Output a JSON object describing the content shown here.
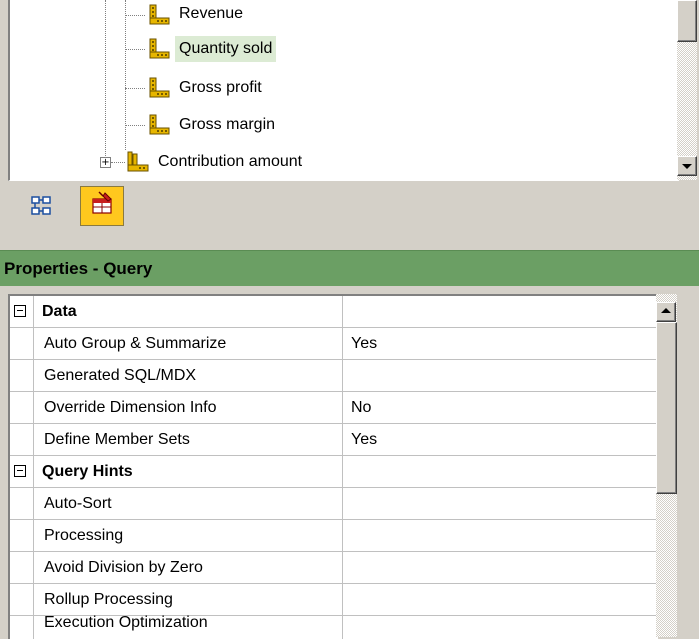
{
  "tree": {
    "items": [
      {
        "label": "Revenue",
        "icon": "measure-icon"
      },
      {
        "label": "Quantity sold",
        "icon": "measure-icon",
        "selected": true
      },
      {
        "label": "Gross profit",
        "icon": "measure-icon"
      },
      {
        "label": "Gross margin",
        "icon": "measure-icon"
      },
      {
        "label": "Contribution amount",
        "icon": "measure-folder-icon",
        "expandable": true
      }
    ]
  },
  "toolbar": {
    "buttons": [
      {
        "name": "tree-view-button",
        "icon": "tree-structure-icon",
        "active": false
      },
      {
        "name": "query-properties-button",
        "icon": "query-properties-icon",
        "active": true
      }
    ]
  },
  "properties": {
    "header": "Properties -  Query",
    "groups": [
      {
        "name": "Data",
        "rows": [
          {
            "name": "Auto Group & Summarize",
            "value": "Yes"
          },
          {
            "name": "Generated SQL/MDX",
            "value": ""
          },
          {
            "name": "Override Dimension Info",
            "value": "No"
          },
          {
            "name": "Define Member Sets",
            "value": "Yes"
          }
        ]
      },
      {
        "name": "Query Hints",
        "rows": [
          {
            "name": "Auto-Sort",
            "value": ""
          },
          {
            "name": "Processing",
            "value": ""
          },
          {
            "name": "Avoid Division by Zero",
            "value": ""
          },
          {
            "name": "Rollup Processing",
            "value": ""
          },
          {
            "name": "Execution Optimization",
            "value": ""
          }
        ]
      }
    ]
  },
  "colors": {
    "header_green": "#6b9f64",
    "selected_row": "#dcebd4",
    "active_button": "#ffc81e"
  }
}
